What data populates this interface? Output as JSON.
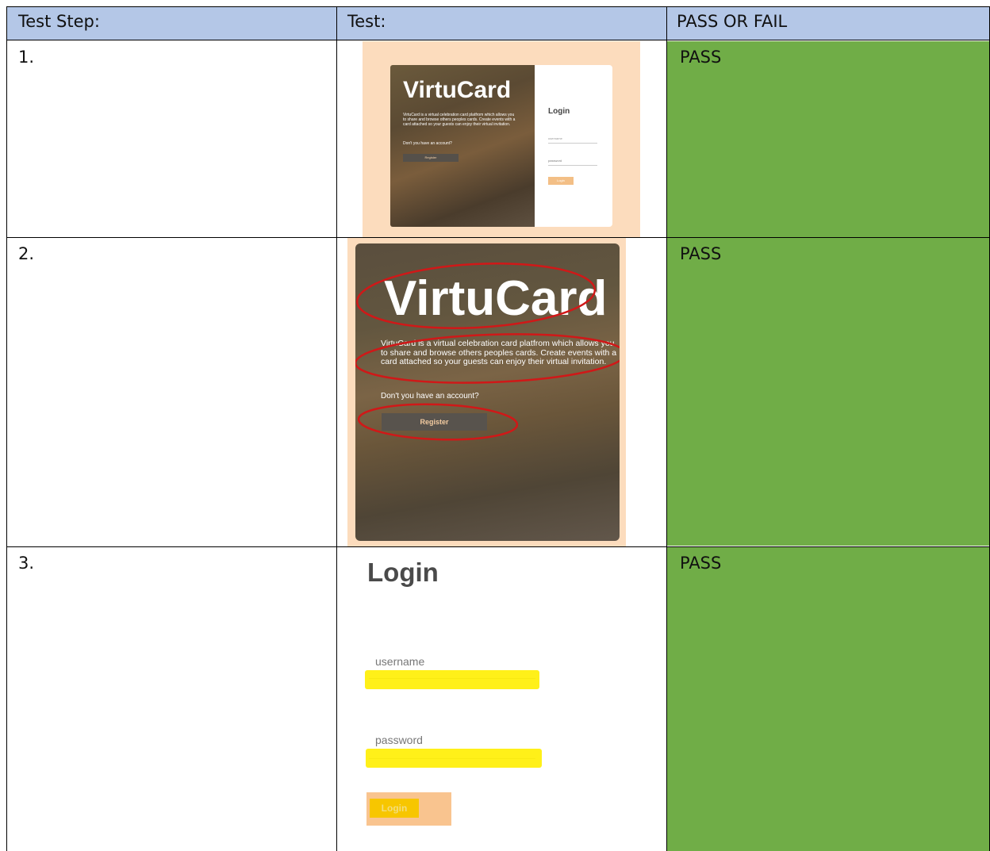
{
  "header": {
    "col1": "Test Step:",
    "col2": "Test:",
    "col3": "PASS OR FAIL"
  },
  "rows": [
    {
      "step": "1.",
      "result": "PASS"
    },
    {
      "step": "2.",
      "result": "PASS"
    },
    {
      "step": "3.",
      "result": "PASS"
    }
  ],
  "shot1": {
    "title": "VirtuCard",
    "description": "VirtuCard is a virtual celebration card platfrom which allows you to share and browse others peoples cards. Create events with a card attached so your guests can enjoy their virtual invitation.",
    "question": "Don't you have an account?",
    "register": "Register",
    "login_title": "Login",
    "username": "username",
    "password": "password",
    "login_button": "Login"
  },
  "shot2": {
    "title": "VirtuCard",
    "description": "VirtuCard is a virtual celebration card platfrom which allows you to share and browse others peoples cards. Create events with a card attached so your guests can enjoy their virtual invitation.",
    "question": "Don't you have an account?",
    "register": "Register"
  },
  "shot3": {
    "login_title": "Login",
    "username": "username",
    "password": "password",
    "login_button": "Login"
  },
  "colors": {
    "header_bg": "#b4c7e7",
    "pass_bg": "#70ad47",
    "annotation_red": "#d01818",
    "highlight_yellow": "#ffee00"
  }
}
